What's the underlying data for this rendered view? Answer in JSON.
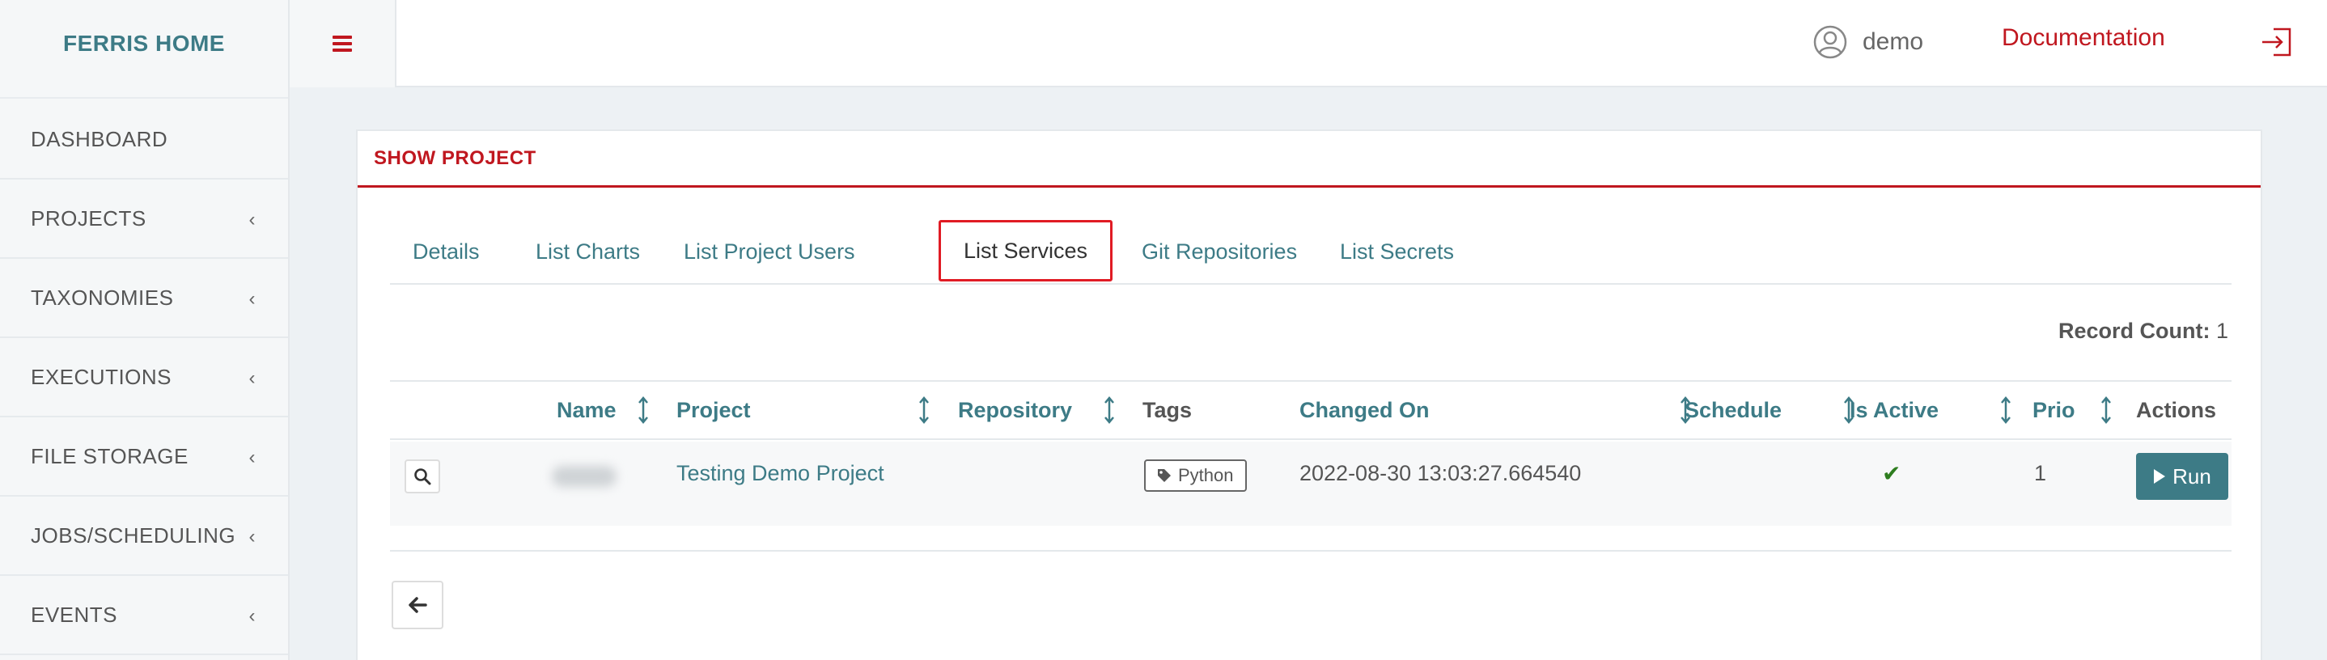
{
  "brand": "FERRIS HOME",
  "topbar": {
    "user_name": "demo",
    "documentation_label": "Documentation"
  },
  "sidebar": {
    "items": [
      {
        "label": "DASHBOARD",
        "has_chevron": false
      },
      {
        "label": "PROJECTS",
        "has_chevron": true
      },
      {
        "label": "TAXONOMIES",
        "has_chevron": true
      },
      {
        "label": "EXECUTIONS",
        "has_chevron": true
      },
      {
        "label": "FILE STORAGE",
        "has_chevron": true
      },
      {
        "label": "JOBS/SCHEDULING",
        "has_chevron": true
      },
      {
        "label": "EVENTS",
        "has_chevron": true
      }
    ],
    "chevron": "‹"
  },
  "card": {
    "title": "SHOW PROJECT"
  },
  "tabs": [
    {
      "label": "Details",
      "active": false
    },
    {
      "label": "List Charts",
      "active": false
    },
    {
      "label": "List Project Users",
      "active": false
    },
    {
      "label": "List Services",
      "active": true
    },
    {
      "label": "Git Repositories",
      "active": false
    },
    {
      "label": "List Secrets",
      "active": false
    }
  ],
  "record_count": {
    "label": "Record Count:",
    "value": "1"
  },
  "table": {
    "columns": [
      "Name",
      "Project",
      "Repository",
      "Tags",
      "Changed On",
      "Schedule",
      "Is Active",
      "Prio",
      "Actions"
    ],
    "rows": [
      {
        "name": "",
        "project": "Testing Demo Project",
        "repository": "",
        "tag": "Python",
        "changed_on": "2022-08-30 13:03:27.664540",
        "schedule": "",
        "is_active": "✔",
        "prio": "1",
        "action_label": "Run"
      }
    ]
  },
  "colors": {
    "accent_red": "#c0171f",
    "teal": "#3d7b86",
    "active_check": "#2e7d1f"
  },
  "icons": [
    "user-circle-icon",
    "logout-icon",
    "hamburger-icon",
    "search-icon",
    "tag-icon",
    "play-icon",
    "arrow-left-icon",
    "sort-icon",
    "check-icon"
  ]
}
